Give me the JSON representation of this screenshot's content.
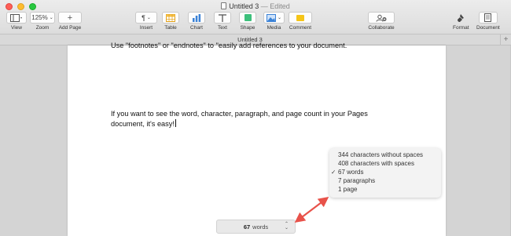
{
  "window": {
    "title": "Untitled 3",
    "status": "— Edited"
  },
  "toolbar": {
    "view_label": "View",
    "zoom_value": "125%",
    "zoom_label": "Zoom",
    "add_page_label": "Add Page",
    "insert_label": "Insert",
    "table_label": "Table",
    "chart_label": "Chart",
    "text_label": "Text",
    "shape_label": "Shape",
    "media_label": "Media",
    "comment_label": "Comment",
    "collaborate_label": "Collaborate",
    "format_label": "Format",
    "document_label": "Document"
  },
  "tab": {
    "title": "Untitled 3"
  },
  "document": {
    "cut_line": "Use \"footnotes\" or \"endnotes\" to \"easily add references to your document.",
    "line1": "If you want to see the word, character, paragraph, and page count in your Pages",
    "line2": "document, it's easy!"
  },
  "count_menu": {
    "items": [
      {
        "label": "344 characters without spaces",
        "checked": false
      },
      {
        "label": "408 characters with spaces",
        "checked": false
      },
      {
        "label": "67 words",
        "checked": true
      },
      {
        "label": "7 paragraphs",
        "checked": false
      },
      {
        "label": "1 page",
        "checked": false
      }
    ],
    "check_mark": "✓"
  },
  "word_count": {
    "number": "67",
    "unit": "words"
  },
  "colors": {
    "annotation_arrow": "#e8524a",
    "shape_green": "#3dc07c",
    "comment_yellow": "#f5c518",
    "media_blue": "#3b82d6"
  }
}
